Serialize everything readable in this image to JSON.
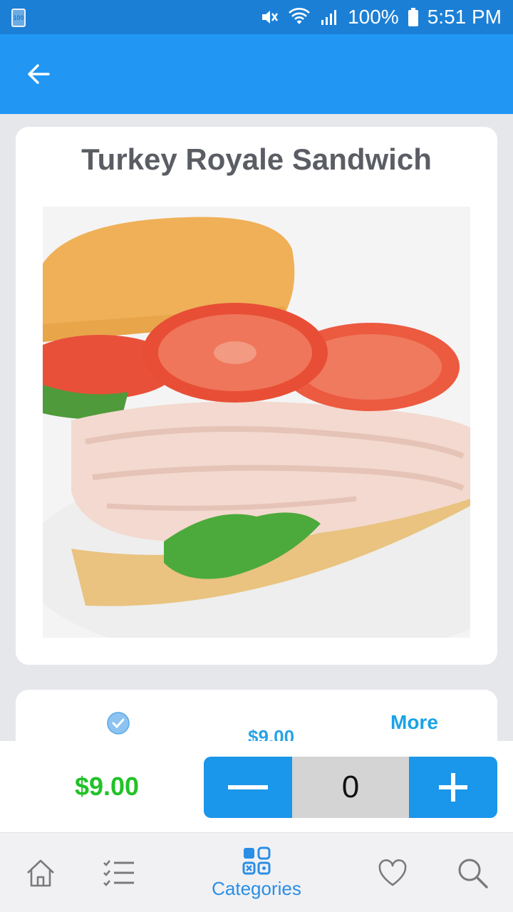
{
  "status_bar": {
    "battery_small_text": "100",
    "battery_percent": "100%",
    "time": "5:51 PM"
  },
  "app_bar": {
    "back_icon": "arrow-left-icon"
  },
  "product": {
    "title": "Turkey Royale Sandwich",
    "image_icon": "sandwich-photo"
  },
  "options": {
    "selected_icon": "check-circle-icon",
    "price_partial": "$9.00",
    "more_label": "More"
  },
  "action_bar": {
    "price": "$9.00",
    "quantity": "0",
    "minus_icon": "minus-icon",
    "plus_icon": "plus-icon"
  },
  "bottom_nav": {
    "items": [
      {
        "icon": "home-icon",
        "label": ""
      },
      {
        "icon": "checklist-icon",
        "label": ""
      },
      {
        "icon": "categories-icon",
        "label": "Categories"
      },
      {
        "icon": "heart-icon",
        "label": ""
      },
      {
        "icon": "search-icon",
        "label": ""
      }
    ],
    "active_index": 2
  },
  "colors": {
    "status_bar": "#1b7fd6",
    "app_bar": "#2196f3",
    "price_green": "#21c227",
    "accent_blue": "#1a96ea"
  }
}
